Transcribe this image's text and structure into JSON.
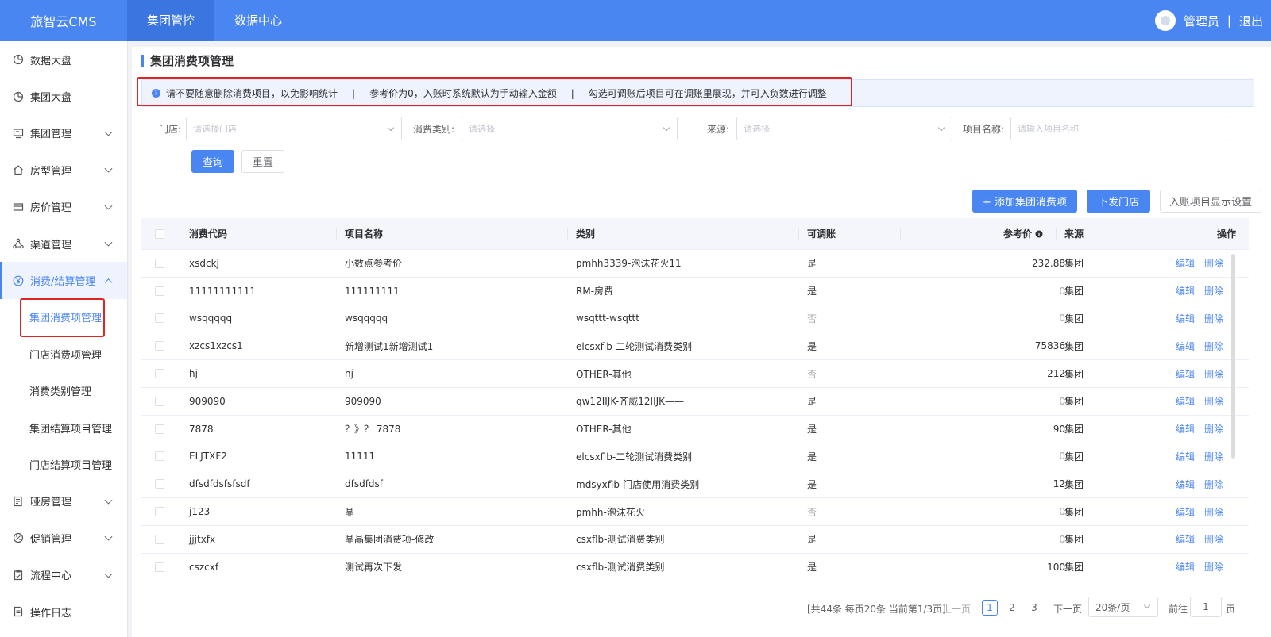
{
  "app": {
    "title": "旅智云CMS"
  },
  "topnav": {
    "items": [
      "集团管控",
      "数据中心"
    ]
  },
  "user": {
    "name": "管理员",
    "separator": "|",
    "logout": "退出"
  },
  "sidebar": {
    "items": [
      {
        "label": "数据大盘"
      },
      {
        "label": "集团大盘"
      },
      {
        "label": "集团管理"
      },
      {
        "label": "房型管理"
      },
      {
        "label": "房价管理"
      },
      {
        "label": "渠道管理"
      },
      {
        "label": "消费/结算管理"
      },
      {
        "label": "哑房管理"
      },
      {
        "label": "促销管理"
      },
      {
        "label": "流程中心"
      },
      {
        "label": "操作日志"
      }
    ],
    "sub_items": [
      "集团消费项管理",
      "门店消费项管理",
      "消费类别管理",
      "集团结算项目管理",
      "门店结算项目管理"
    ]
  },
  "page": {
    "title": "集团消费项管理"
  },
  "notice": {
    "msg1": "请不要随意删除消费项目，以免影响统计",
    "sep": "|",
    "msg2": "参考价为0，入账时系统默认为手动输入金额",
    "msg3": "勾选可调账后项目可在调账里展现，并可入负数进行调整"
  },
  "filters": {
    "store_label": "门店:",
    "store_placeholder": "请选择门店",
    "category_label": "消费类别:",
    "category_placeholder": "请选择",
    "source_label": "来源:",
    "source_placeholder": "请选择",
    "name_label": "项目名称:",
    "name_placeholder": "请输入项目名称"
  },
  "buttons": {
    "query": "查询",
    "reset": "重置",
    "add": "+ 添加集团消费项",
    "dispatch": "下发门店",
    "display_settings": "入账项目显示设置"
  },
  "table": {
    "headers": {
      "code": "消费代码",
      "name": "项目名称",
      "category": "类别",
      "adjustable": "可调账",
      "price": "参考价",
      "source": "来源",
      "ops": "操作"
    },
    "edit": "编辑",
    "delete": "删除",
    "rows": [
      {
        "code": "xsdckj",
        "name": "小数点参考价",
        "category": "pmhh3339-泡沫花火11",
        "adjustable": "是",
        "price": "232.88",
        "source": "集团"
      },
      {
        "code": "11111111111",
        "name": "111111111",
        "category": "RM-房费",
        "adjustable": "是",
        "price": "0",
        "source": "集团"
      },
      {
        "code": "wsqqqqq",
        "name": "wsqqqqq",
        "category": "wsqttt-wsqttt",
        "adjustable": "否",
        "price": "0",
        "source": "集团"
      },
      {
        "code": "xzcs1xzcs1",
        "name": "新增测试1新增测试1",
        "category": "elcsxflb-二轮测试消费类别",
        "adjustable": "是",
        "price": "75836",
        "source": "集团"
      },
      {
        "code": "hj",
        "name": "hj",
        "category": "OTHER-其他",
        "adjustable": "否",
        "price": "212",
        "source": "集团"
      },
      {
        "code": "909090",
        "name": "909090",
        "category": "qw12IIJK-齐威12IIJK——",
        "adjustable": "是",
        "price": "0",
        "source": "集团"
      },
      {
        "code": "7878",
        "name": "？》？ 7878",
        "category": "OTHER-其他",
        "adjustable": "是",
        "price": "90",
        "source": "集团"
      },
      {
        "code": "ELJTXF2",
        "name": "11111",
        "category": "elcsxflb-二轮测试消费类别",
        "adjustable": "是",
        "price": "0",
        "source": "集团"
      },
      {
        "code": "dfsdfdsfsfsdf",
        "name": "dfsdfdsf",
        "category": "mdsyxflb-门店使用消费类别",
        "adjustable": "是",
        "price": "12",
        "source": "集团"
      },
      {
        "code": "j123",
        "name": "晶",
        "category": "pmhh-泡沫花火",
        "adjustable": "否",
        "price": "0",
        "source": "集团"
      },
      {
        "code": "jjjtxfx",
        "name": "晶晶集团消费项-修改",
        "category": "csxflb-测试消费类别",
        "adjustable": "是",
        "price": "0",
        "source": "集团"
      },
      {
        "code": "cszcxf",
        "name": "测试再次下发",
        "category": "csxflb-测试消费类别",
        "adjustable": "是",
        "price": "100",
        "source": "集团"
      }
    ]
  },
  "pager": {
    "summary": "[共44条 每页20条 当前第1/3页]",
    "prev": "上一页",
    "pages": [
      "1",
      "2",
      "3"
    ],
    "next": "下一页",
    "page_size": "20条/页",
    "goto_label": "前往",
    "goto_value": "1",
    "page_unit": "页"
  }
}
